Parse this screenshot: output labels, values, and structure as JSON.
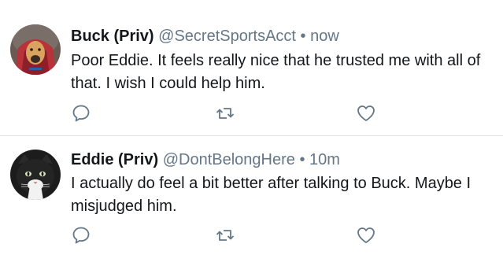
{
  "tweets": [
    {
      "display_name": "Buck (Priv)",
      "handle": "@SecretSportsAcct",
      "separator": "•",
      "time": "now",
      "text": "Poor Eddie. It feels really nice that he trusted me with all of that. I wish I could help him.",
      "avatar_icon": "dog-in-red-hoodie-avatar"
    },
    {
      "display_name": "Eddie (Priv)",
      "handle": "@DontBelongHere",
      "separator": "•",
      "time": "10m",
      "text": "I actually do feel a bit better after talking to Buck. Maybe I misjudged him.",
      "avatar_icon": "tuxedo-cat-avatar"
    }
  ],
  "action_icons": [
    "reply-icon",
    "retweet-icon",
    "like-icon"
  ],
  "colors": {
    "text": "#14171a",
    "secondary": "#657786",
    "divider": "#dcdfe3",
    "icon": "#657786"
  }
}
